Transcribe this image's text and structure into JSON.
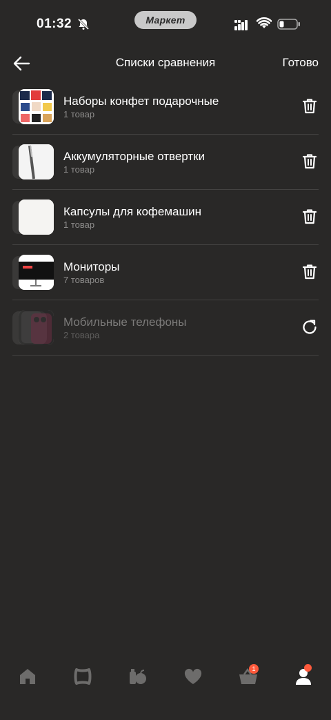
{
  "status_bar": {
    "time": "01:32",
    "app_pill": "Маркет",
    "icons": [
      "bell-off-icon",
      "signal-icon",
      "wifi-icon",
      "battery-icon"
    ]
  },
  "header": {
    "title": "Списки сравнения",
    "done_label": "Готово",
    "back_icon": "arrow-left-icon"
  },
  "lists": [
    {
      "name": "Наборы конфет подарочные",
      "count": "1 товар",
      "action_icon": "trash-icon",
      "disabled": false
    },
    {
      "name": "Аккумуляторные отвертки",
      "count": "1 товар",
      "action_icon": "trash-icon",
      "disabled": false
    },
    {
      "name": "Капсулы для кофемашин",
      "count": "1 товар",
      "action_icon": "trash-icon",
      "disabled": false
    },
    {
      "name": "Мониторы",
      "count": "7 товаров",
      "action_icon": "trash-icon",
      "disabled": false
    },
    {
      "name": "Мобильные телефоны",
      "count": "2 товара",
      "action_icon": "restore-icon",
      "disabled": true
    }
  ],
  "bottom_nav": {
    "items": [
      "home-icon",
      "catalog-icon",
      "grocery-icon",
      "favorites-icon",
      "cart-icon",
      "profile-icon"
    ],
    "cart_badge": "1"
  },
  "colors": {
    "background": "#292827",
    "divider": "#444342",
    "badge": "#ff5a3c"
  }
}
